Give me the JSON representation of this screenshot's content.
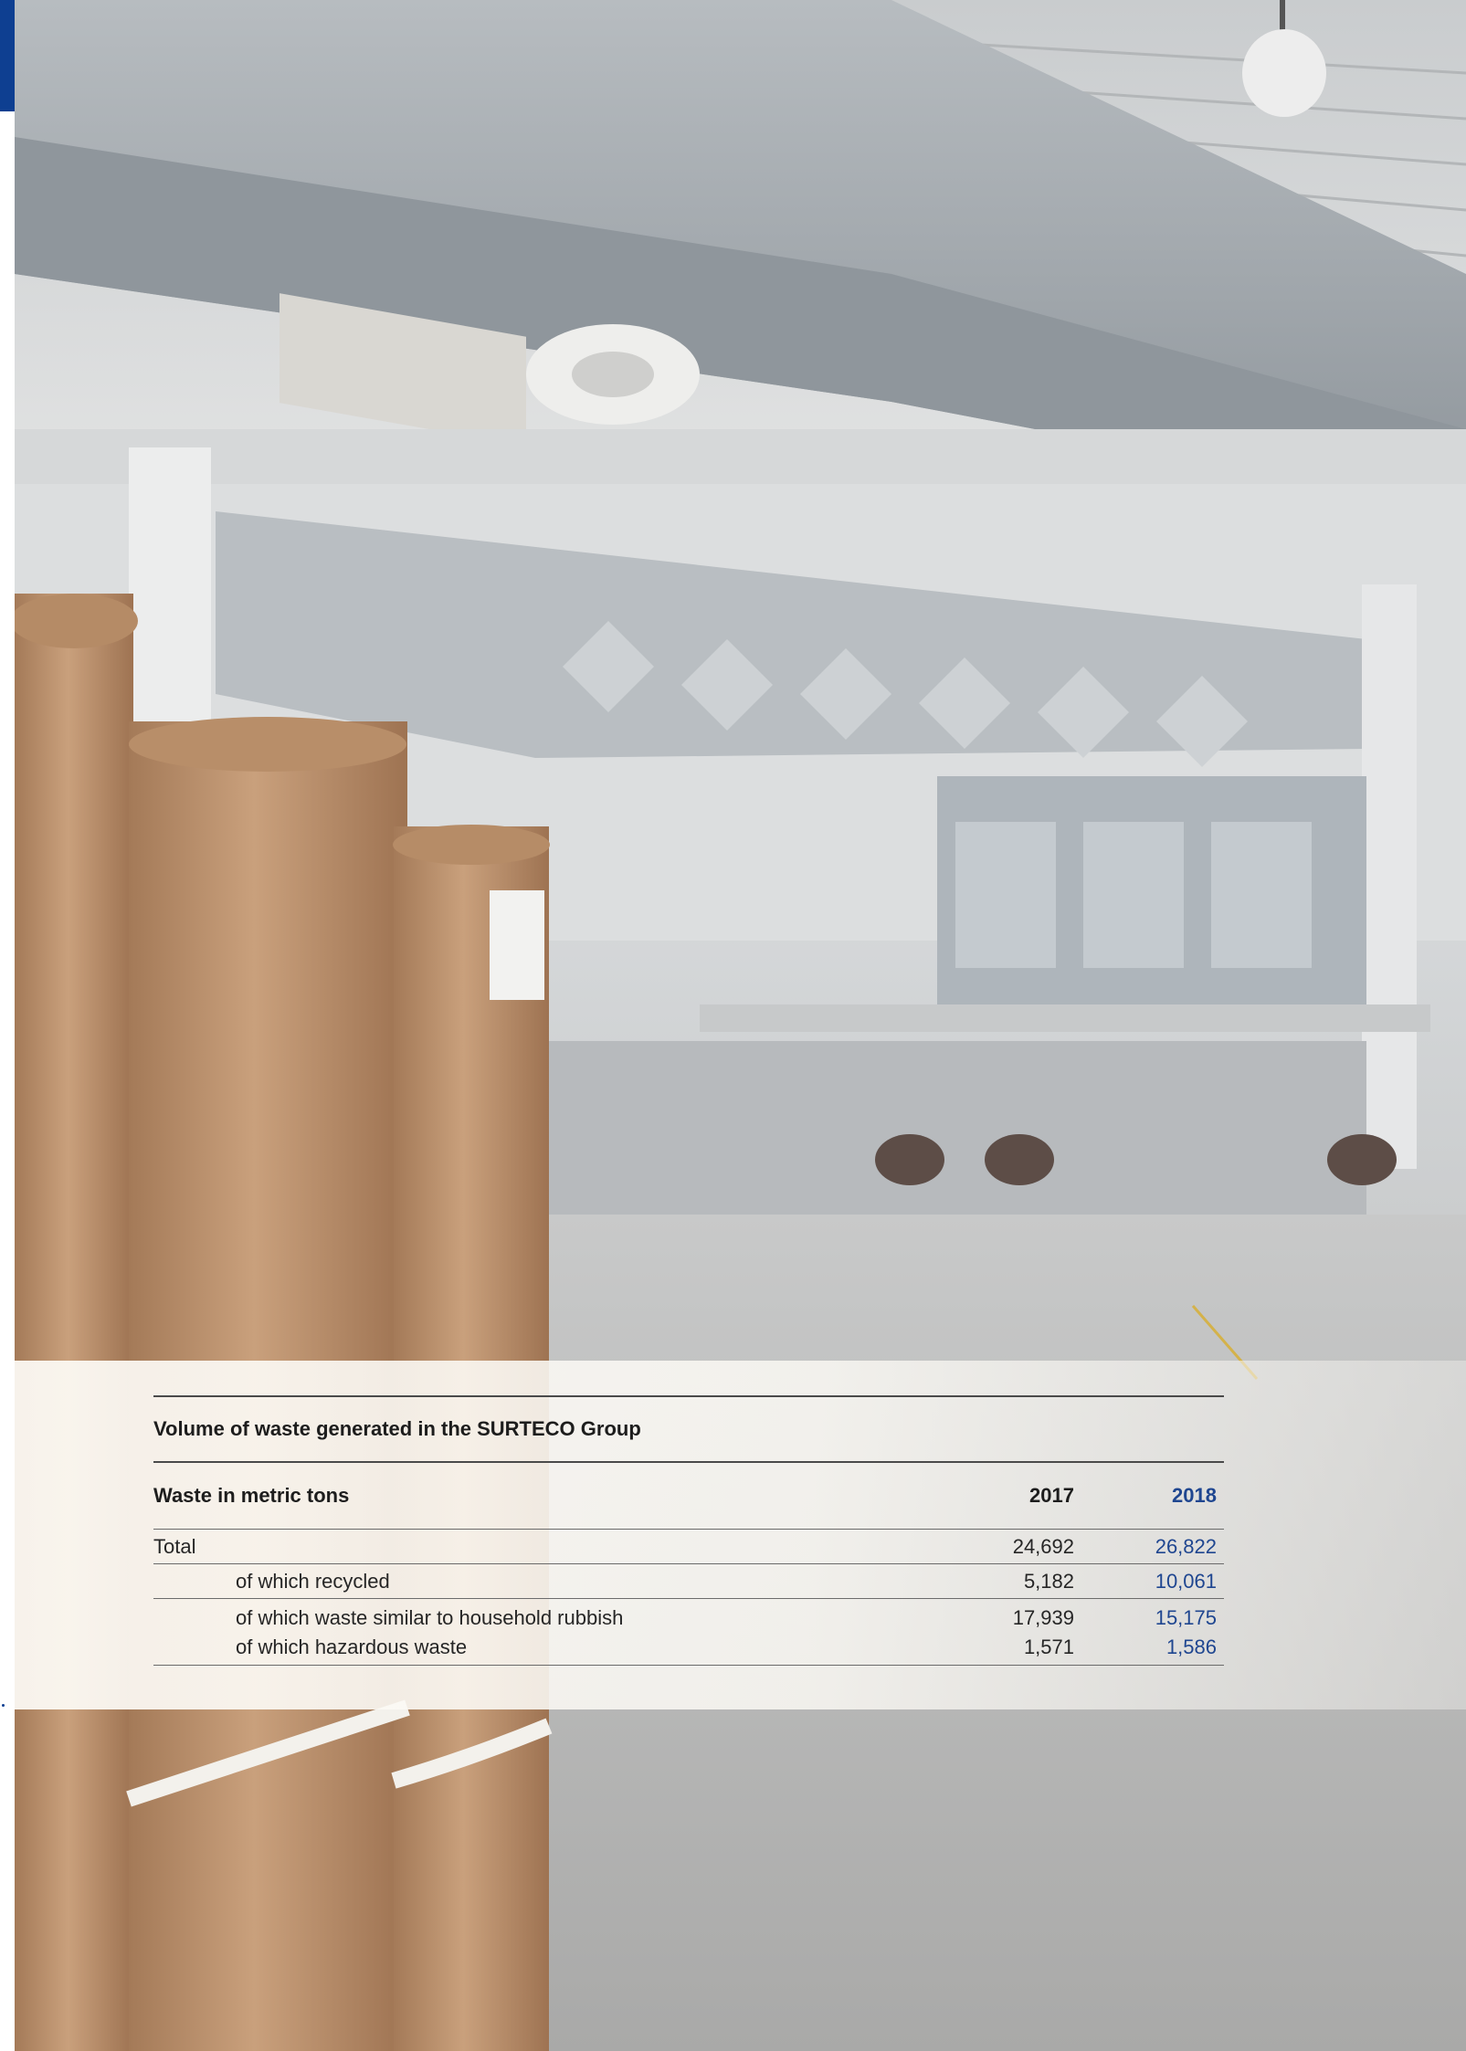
{
  "colors": {
    "accent_blue": "#0e3f91",
    "highlight_year": "#1f4690",
    "text": "#262626"
  },
  "table": {
    "title": "Volume of waste generated in the SURTECO Group",
    "header": {
      "label": "Waste in metric tons",
      "year_a": "2017",
      "year_b": "2018"
    },
    "rows": [
      {
        "label": "Total",
        "a": "24,692",
        "b": "26,822"
      },
      {
        "label": "of which recycled",
        "a": "5,182",
        "b": "10,061"
      },
      {
        "label": "of which waste similar to household rubbish",
        "a": "17,939",
        "b": "15,175"
      },
      {
        "label": "of which hazardous waste",
        "a": "1,571",
        "b": "1,586"
      }
    ]
  }
}
